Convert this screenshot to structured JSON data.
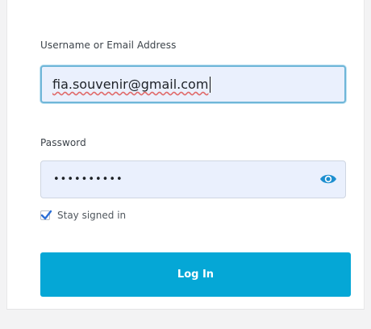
{
  "form": {
    "username_label": "Username or Email Address",
    "username_value": "fia.souvenir@gmail.com",
    "password_label": "Password",
    "password_masked": "••••••••••",
    "show_password_icon": "eye-icon",
    "remember_label": "Stay signed in",
    "remember_checked": true,
    "submit_label": "Log In"
  },
  "colors": {
    "button": "#05a7d6",
    "input_background": "#eaf0fd",
    "focus_border": "#6fb6d8",
    "checkmark": "#2b6fd6"
  }
}
